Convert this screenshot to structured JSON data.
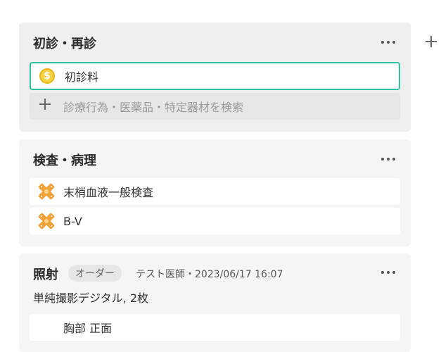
{
  "cards": [
    {
      "title": "初診・再診",
      "items": [
        {
          "label": "初診料",
          "icon": "dollar-coin-icon",
          "selected": true
        }
      ],
      "search_placeholder": "診療行為・医薬品・特定器材を検索"
    },
    {
      "title": "検査・病理",
      "items": [
        {
          "label": "末梢血液一般検査",
          "icon": "bandage-icon"
        },
        {
          "label": "B-V",
          "icon": "bandage-icon"
        }
      ]
    },
    {
      "title": "照射",
      "badge": "オーダー",
      "meta": "テスト医師・2023/06/17 16:07",
      "description": "単純撮影デジタル, 2枚",
      "items": [
        {
          "label": "胸部 正面"
        }
      ]
    }
  ],
  "colors": {
    "selected_border": "#2ec4a0",
    "coin": "#f7d13f",
    "bandage": "#f0a23a"
  }
}
